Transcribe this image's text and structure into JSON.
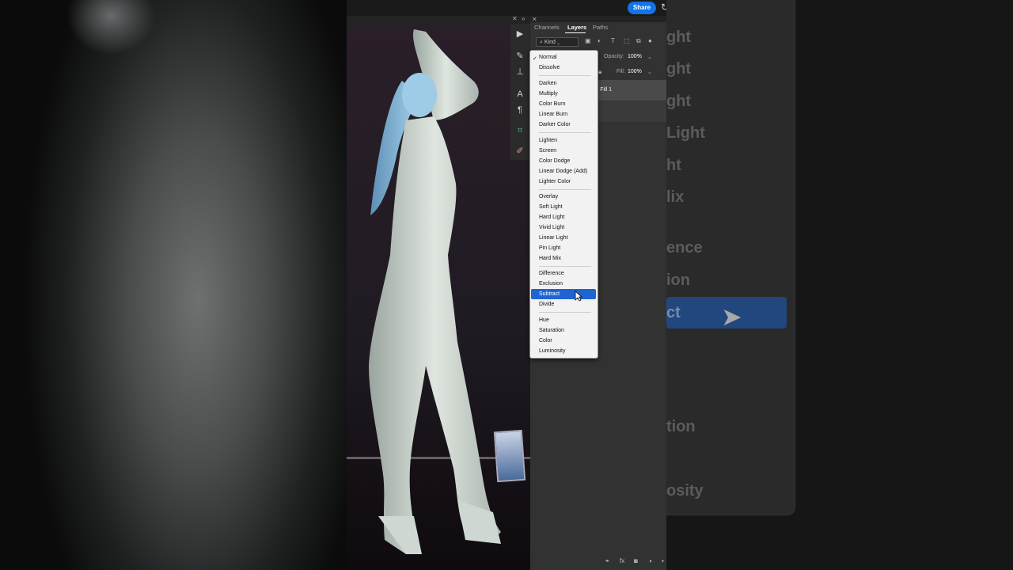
{
  "header": {
    "share_label": "Share",
    "refresh_icon": "refresh-icon"
  },
  "panel": {
    "tabs": [
      {
        "label": "Channels"
      },
      {
        "label": "Layers"
      },
      {
        "label": "Paths"
      }
    ],
    "filter_kind": "Kind",
    "opacity_label": "Opacity:",
    "opacity_value": "100%",
    "fill_label": "Fill:",
    "fill_value": "100%",
    "layer_name": "r Fill 1"
  },
  "blend_menu": {
    "selected": "Normal",
    "highlighted": "Subtract",
    "items": [
      "Normal",
      "Dissolve",
      "Darken",
      "Multiply",
      "Color Burn",
      "Linear Burn",
      "Darker Color",
      "Lighten",
      "Screen",
      "Color Dodge",
      "Linear Dodge (Add)",
      "Lighter Color",
      "Overlay",
      "Soft Light",
      "Hard Light",
      "Vivid Light",
      "Linear Light",
      "Pin Light",
      "Hard Mix",
      "Difference",
      "Exclusion",
      "Subtract",
      "Divide",
      "Hue",
      "Saturation",
      "Color",
      "Luminosity"
    ]
  },
  "background_ghost": {
    "labels": [
      "ght",
      "ght",
      "ght",
      "Light",
      "ht",
      "lix",
      "ence",
      "ion",
      "ct",
      "tion",
      "osity"
    ]
  },
  "colors": {
    "accent": "#1473e6",
    "highlight": "#1f64d2",
    "panel": "#323232"
  }
}
